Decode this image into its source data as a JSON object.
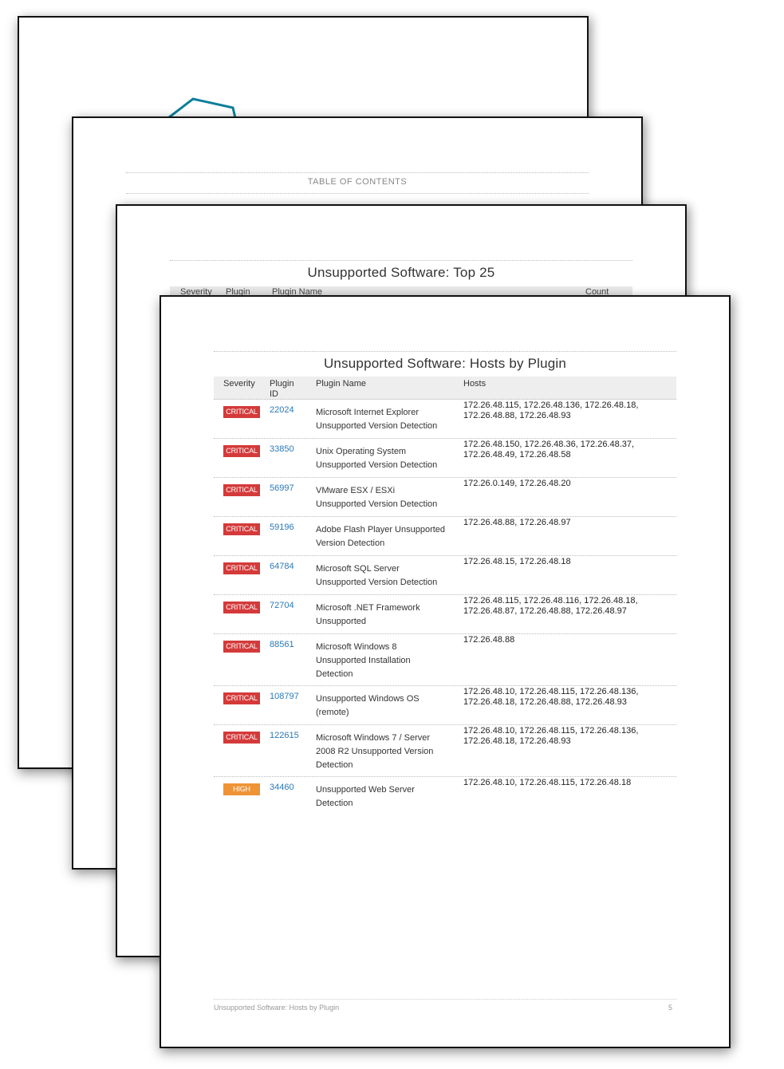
{
  "pages": {
    "cover": {},
    "toc": {
      "title": "TABLE OF CONTENTS"
    },
    "top25": {
      "title": "Unsupported Software: Top 25",
      "columns": [
        "Severity",
        "Plugin",
        "Plugin Name",
        "Count"
      ]
    },
    "hosts_by_plugin": {
      "title": "Unsupported Software: Hosts by Plugin",
      "columns": {
        "severity": "Severity",
        "plugin_id_line1": "Plugin",
        "plugin_id_line2": "ID",
        "plugin_name": "Plugin Name",
        "hosts": "Hosts"
      },
      "rows": [
        {
          "severity": "CRITICAL",
          "plugin_id": "22024",
          "name_lines": [
            "Microsoft Internet Explorer",
            "Unsupported Version Detection"
          ],
          "host_lines": [
            "172.26.48.115, 172.26.48.136, 172.26.48.18,",
            "172.26.48.88, 172.26.48.93"
          ]
        },
        {
          "severity": "CRITICAL",
          "plugin_id": "33850",
          "name_lines": [
            "Unix Operating System",
            "Unsupported Version Detection"
          ],
          "host_lines": [
            "172.26.48.150, 172.26.48.36, 172.26.48.37,",
            "172.26.48.49, 172.26.48.58"
          ]
        },
        {
          "severity": "CRITICAL",
          "plugin_id": "56997",
          "name_lines": [
            "VMware ESX / ESXi",
            "Unsupported Version Detection"
          ],
          "host_lines": [
            "172.26.0.149, 172.26.48.20"
          ]
        },
        {
          "severity": "CRITICAL",
          "plugin_id": "59196",
          "name_lines": [
            "Adobe Flash Player Unsupported",
            "Version Detection"
          ],
          "host_lines": [
            "172.26.48.88, 172.26.48.97"
          ]
        },
        {
          "severity": "CRITICAL",
          "plugin_id": "64784",
          "name_lines": [
            "Microsoft SQL Server",
            "Unsupported Version Detection"
          ],
          "host_lines": [
            "172.26.48.15, 172.26.48.18"
          ]
        },
        {
          "severity": "CRITICAL",
          "plugin_id": "72704",
          "name_lines": [
            "Microsoft .NET Framework",
            "Unsupported"
          ],
          "host_lines": [
            "172.26.48.115, 172.26.48.116, 172.26.48.18,",
            "172.26.48.87, 172.26.48.88, 172.26.48.97"
          ]
        },
        {
          "severity": "CRITICAL",
          "plugin_id": "88561",
          "name_lines": [
            "Microsoft Windows 8",
            "Unsupported Installation",
            "Detection"
          ],
          "host_lines": [
            "172.26.48.88"
          ]
        },
        {
          "severity": "CRITICAL",
          "plugin_id": "108797",
          "name_lines": [
            "Unsupported Windows OS",
            "(remote)"
          ],
          "host_lines": [
            "172.26.48.10, 172.26.48.115, 172.26.48.136,",
            "172.26.48.18, 172.26.48.88, 172.26.48.93"
          ]
        },
        {
          "severity": "CRITICAL",
          "plugin_id": "122615",
          "name_lines": [
            "Microsoft Windows 7 / Server",
            "2008 R2 Unsupported Version",
            "Detection"
          ],
          "host_lines": [
            "172.26.48.10, 172.26.48.115, 172.26.48.136,",
            "172.26.48.18, 172.26.48.93"
          ]
        },
        {
          "severity": "HIGH",
          "plugin_id": "34460",
          "name_lines": [
            "Unsupported Web Server",
            "Detection"
          ],
          "host_lines": [
            "172.26.48.10, 172.26.48.115, 172.26.48.18"
          ]
        }
      ],
      "footer": {
        "section": "Unsupported Software: Hosts by Plugin",
        "page_number": "5"
      }
    }
  },
  "severity_colors": {
    "CRITICAL": "#d43a3a",
    "HIGH": "#ee9336"
  },
  "accent_color": "#0e7f9a"
}
